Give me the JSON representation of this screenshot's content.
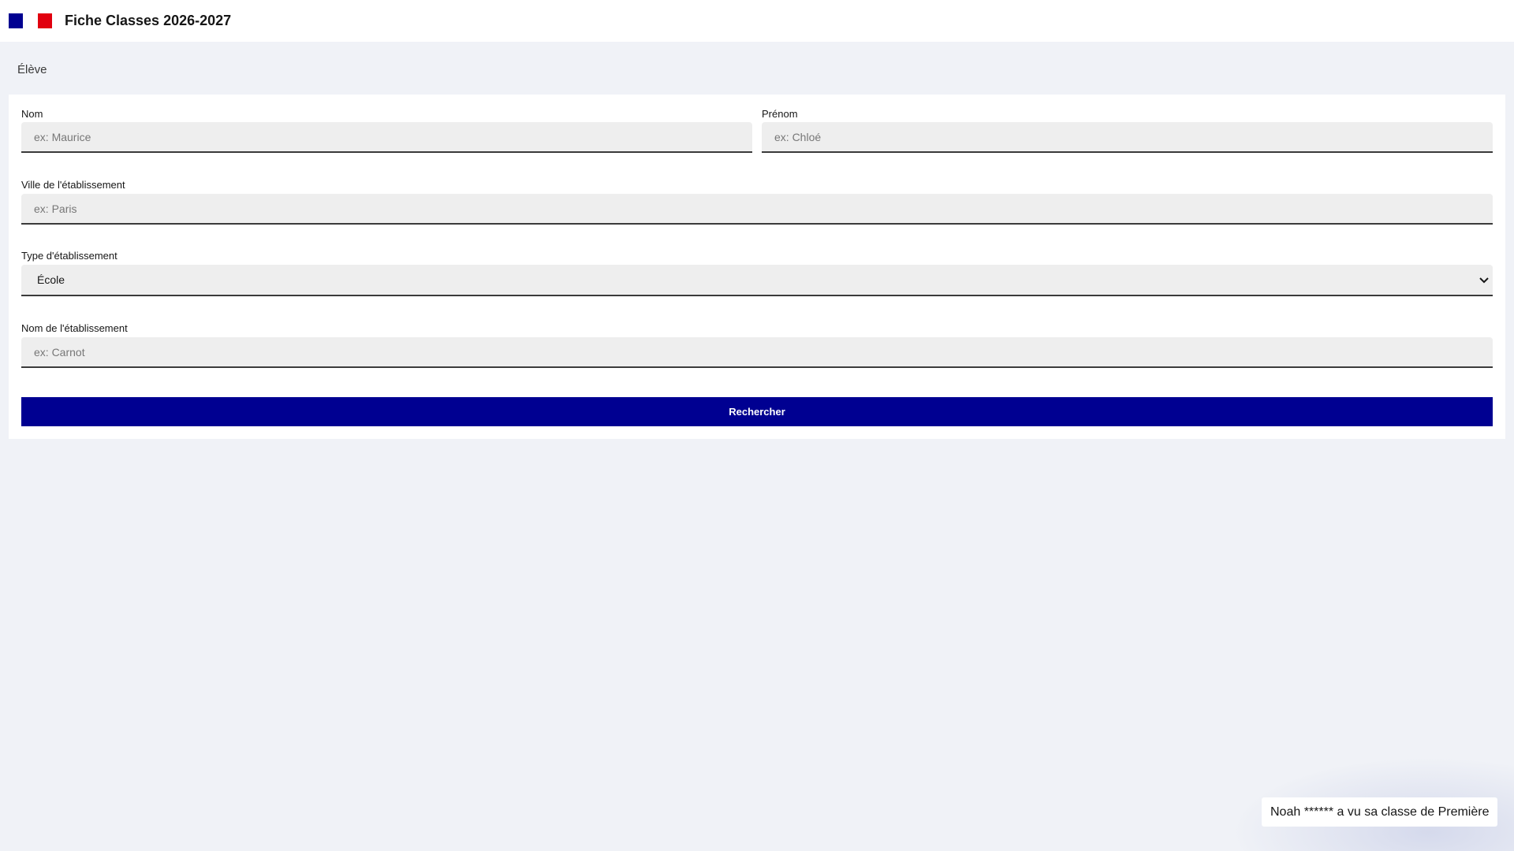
{
  "header": {
    "title": "Fiche Classes 2026-2027",
    "flag_colors": [
      "#000091",
      "#e1000f"
    ]
  },
  "section": {
    "label": "Élève"
  },
  "form": {
    "nom": {
      "label": "Nom",
      "placeholder": "ex: Maurice"
    },
    "prenom": {
      "label": "Prénom",
      "placeholder": "ex: Chloé"
    },
    "ville": {
      "label": "Ville de l'établissement",
      "placeholder": "ex: Paris"
    },
    "type": {
      "label": "Type d'établissement",
      "selected": "École"
    },
    "etablissement": {
      "label": "Nom de l'établissement",
      "placeholder": "ex: Carnot"
    },
    "submit_label": "Rechercher"
  },
  "toast": {
    "message": "Noah ****** a vu sa classe de Première"
  },
  "colors": {
    "primary": "#000091",
    "accent_red": "#e1000f",
    "background": "#f0f2f7"
  }
}
